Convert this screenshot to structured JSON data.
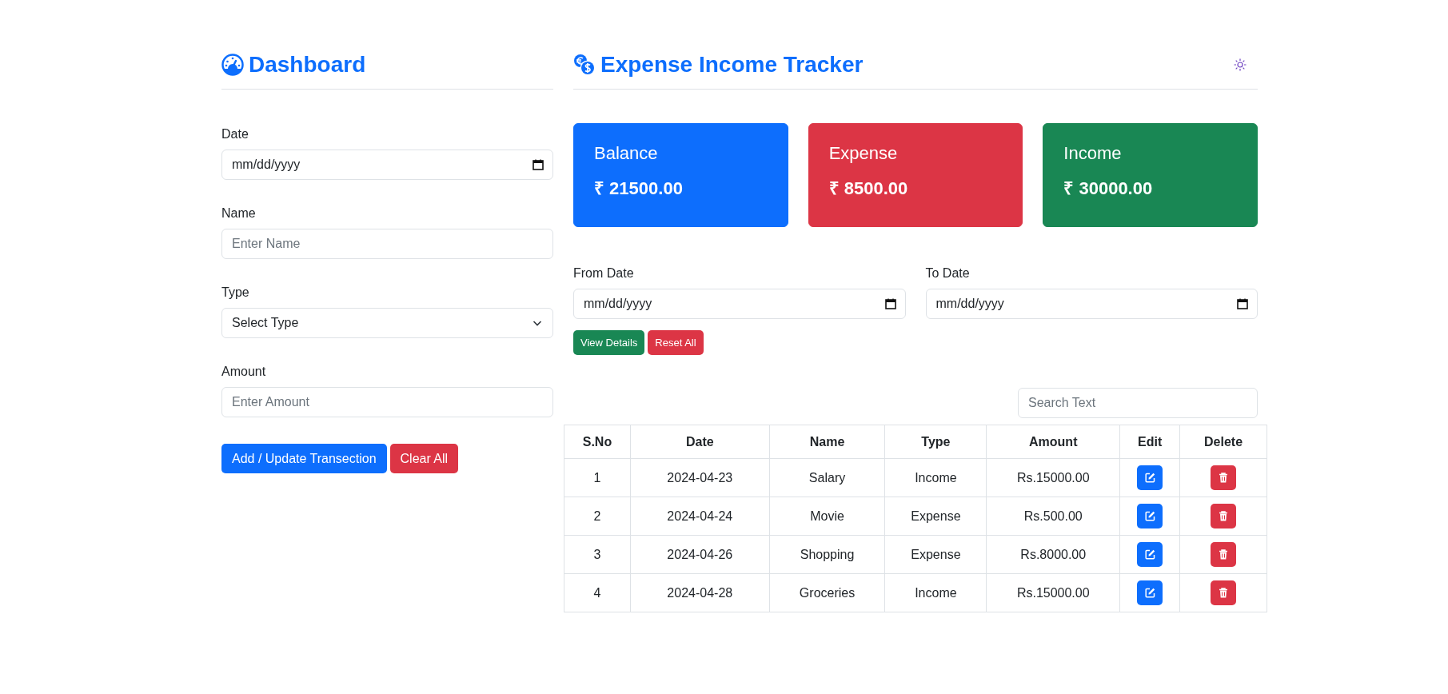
{
  "sidebar": {
    "title": "Dashboard",
    "fields": [
      {
        "kind": "date",
        "label": "Date",
        "placeholder": "mm/dd/yyyy"
      },
      {
        "kind": "text",
        "label": "Name",
        "placeholder": "Enter Name"
      },
      {
        "kind": "select",
        "label": "Type",
        "value": "Select Type"
      },
      {
        "kind": "text",
        "label": "Amount",
        "placeholder": "Enter Amount"
      }
    ],
    "buttons": [
      {
        "label": "Add / Update Transection",
        "color": "#0d6efd"
      },
      {
        "label": "Clear All",
        "color": "#dc3545"
      }
    ]
  },
  "header": {
    "title": "Expense Income Tracker"
  },
  "cards": [
    {
      "title": "Balance",
      "value": "₹ 21500.00",
      "color": "#0d6efd"
    },
    {
      "title": "Expense",
      "value": "₹ 8500.00",
      "color": "#dc3545"
    },
    {
      "title": "Income",
      "value": "₹ 30000.00",
      "color": "#198754"
    }
  ],
  "filter": {
    "fields": [
      {
        "label": "From Date",
        "placeholder": "mm/dd/yyyy"
      },
      {
        "label": "To Date",
        "placeholder": "mm/dd/yyyy"
      }
    ],
    "buttons": [
      {
        "label": "View Details",
        "color": "#198754"
      },
      {
        "label": "Reset All",
        "color": "#dc3545"
      }
    ]
  },
  "search": {
    "placeholder": "Search Text"
  },
  "table": {
    "columns": [
      "S.No",
      "Date",
      "Name",
      "Type",
      "Amount",
      "Edit",
      "Delete"
    ],
    "rows": [
      {
        "sno": "1",
        "date": "2024-04-23",
        "name": "Salary",
        "type": "Income",
        "amount": "Rs.15000.00"
      },
      {
        "sno": "2",
        "date": "2024-04-24",
        "name": "Movie",
        "type": "Expense",
        "amount": "Rs.500.00"
      },
      {
        "sno": "3",
        "date": "2024-04-26",
        "name": "Shopping",
        "type": "Expense",
        "amount": "Rs.8000.00"
      },
      {
        "sno": "4",
        "date": "2024-04-28",
        "name": "Groceries",
        "type": "Income",
        "amount": "Rs.15000.00"
      }
    ]
  }
}
